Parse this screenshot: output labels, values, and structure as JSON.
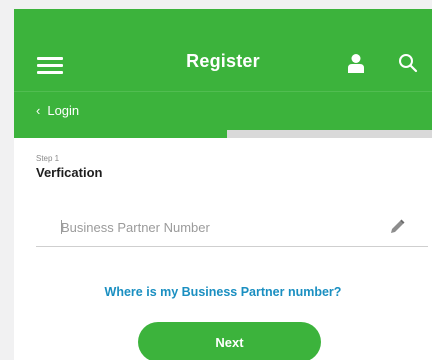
{
  "header": {
    "title": "Register",
    "menu_icon": "hamburger-menu-icon",
    "user_icon": "user-icon",
    "search_icon": "search-icon"
  },
  "subnav": {
    "back_label": "Login",
    "back_icon": "chevron-left-icon"
  },
  "progress": {
    "fraction": 0.51
  },
  "form": {
    "step_label": "Step 1",
    "step_title": "Verfication",
    "partner_field": {
      "placeholder": "Business Partner Number",
      "value": "",
      "edit_icon": "pencil-icon"
    },
    "help_link": "Where is my Business Partner number?",
    "next_label": "Next"
  },
  "colors": {
    "brand_green": "#3cb33c",
    "link_blue": "#1a8fc1",
    "track_gray": "#d9d9d9",
    "background": "#f1f1f2"
  }
}
